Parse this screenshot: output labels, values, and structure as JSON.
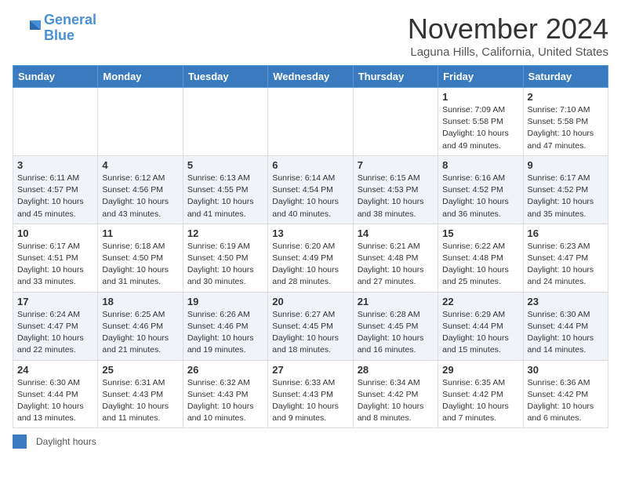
{
  "header": {
    "logo_general": "General",
    "logo_blue": "Blue",
    "month_title": "November 2024",
    "location": "Laguna Hills, California, United States"
  },
  "days_of_week": [
    "Sunday",
    "Monday",
    "Tuesday",
    "Wednesday",
    "Thursday",
    "Friday",
    "Saturday"
  ],
  "weeks": [
    [
      {
        "day": "",
        "info": ""
      },
      {
        "day": "",
        "info": ""
      },
      {
        "day": "",
        "info": ""
      },
      {
        "day": "",
        "info": ""
      },
      {
        "day": "",
        "info": ""
      },
      {
        "day": "1",
        "info": "Sunrise: 7:09 AM\nSunset: 5:58 PM\nDaylight: 10 hours and 49 minutes."
      },
      {
        "day": "2",
        "info": "Sunrise: 7:10 AM\nSunset: 5:58 PM\nDaylight: 10 hours and 47 minutes."
      }
    ],
    [
      {
        "day": "3",
        "info": "Sunrise: 6:11 AM\nSunset: 4:57 PM\nDaylight: 10 hours and 45 minutes."
      },
      {
        "day": "4",
        "info": "Sunrise: 6:12 AM\nSunset: 4:56 PM\nDaylight: 10 hours and 43 minutes."
      },
      {
        "day": "5",
        "info": "Sunrise: 6:13 AM\nSunset: 4:55 PM\nDaylight: 10 hours and 41 minutes."
      },
      {
        "day": "6",
        "info": "Sunrise: 6:14 AM\nSunset: 4:54 PM\nDaylight: 10 hours and 40 minutes."
      },
      {
        "day": "7",
        "info": "Sunrise: 6:15 AM\nSunset: 4:53 PM\nDaylight: 10 hours and 38 minutes."
      },
      {
        "day": "8",
        "info": "Sunrise: 6:16 AM\nSunset: 4:52 PM\nDaylight: 10 hours and 36 minutes."
      },
      {
        "day": "9",
        "info": "Sunrise: 6:17 AM\nSunset: 4:52 PM\nDaylight: 10 hours and 35 minutes."
      }
    ],
    [
      {
        "day": "10",
        "info": "Sunrise: 6:17 AM\nSunset: 4:51 PM\nDaylight: 10 hours and 33 minutes."
      },
      {
        "day": "11",
        "info": "Sunrise: 6:18 AM\nSunset: 4:50 PM\nDaylight: 10 hours and 31 minutes."
      },
      {
        "day": "12",
        "info": "Sunrise: 6:19 AM\nSunset: 4:50 PM\nDaylight: 10 hours and 30 minutes."
      },
      {
        "day": "13",
        "info": "Sunrise: 6:20 AM\nSunset: 4:49 PM\nDaylight: 10 hours and 28 minutes."
      },
      {
        "day": "14",
        "info": "Sunrise: 6:21 AM\nSunset: 4:48 PM\nDaylight: 10 hours and 27 minutes."
      },
      {
        "day": "15",
        "info": "Sunrise: 6:22 AM\nSunset: 4:48 PM\nDaylight: 10 hours and 25 minutes."
      },
      {
        "day": "16",
        "info": "Sunrise: 6:23 AM\nSunset: 4:47 PM\nDaylight: 10 hours and 24 minutes."
      }
    ],
    [
      {
        "day": "17",
        "info": "Sunrise: 6:24 AM\nSunset: 4:47 PM\nDaylight: 10 hours and 22 minutes."
      },
      {
        "day": "18",
        "info": "Sunrise: 6:25 AM\nSunset: 4:46 PM\nDaylight: 10 hours and 21 minutes."
      },
      {
        "day": "19",
        "info": "Sunrise: 6:26 AM\nSunset: 4:46 PM\nDaylight: 10 hours and 19 minutes."
      },
      {
        "day": "20",
        "info": "Sunrise: 6:27 AM\nSunset: 4:45 PM\nDaylight: 10 hours and 18 minutes."
      },
      {
        "day": "21",
        "info": "Sunrise: 6:28 AM\nSunset: 4:45 PM\nDaylight: 10 hours and 16 minutes."
      },
      {
        "day": "22",
        "info": "Sunrise: 6:29 AM\nSunset: 4:44 PM\nDaylight: 10 hours and 15 minutes."
      },
      {
        "day": "23",
        "info": "Sunrise: 6:30 AM\nSunset: 4:44 PM\nDaylight: 10 hours and 14 minutes."
      }
    ],
    [
      {
        "day": "24",
        "info": "Sunrise: 6:30 AM\nSunset: 4:44 PM\nDaylight: 10 hours and 13 minutes."
      },
      {
        "day": "25",
        "info": "Sunrise: 6:31 AM\nSunset: 4:43 PM\nDaylight: 10 hours and 11 minutes."
      },
      {
        "day": "26",
        "info": "Sunrise: 6:32 AM\nSunset: 4:43 PM\nDaylight: 10 hours and 10 minutes."
      },
      {
        "day": "27",
        "info": "Sunrise: 6:33 AM\nSunset: 4:43 PM\nDaylight: 10 hours and 9 minutes."
      },
      {
        "day": "28",
        "info": "Sunrise: 6:34 AM\nSunset: 4:42 PM\nDaylight: 10 hours and 8 minutes."
      },
      {
        "day": "29",
        "info": "Sunrise: 6:35 AM\nSunset: 4:42 PM\nDaylight: 10 hours and 7 minutes."
      },
      {
        "day": "30",
        "info": "Sunrise: 6:36 AM\nSunset: 4:42 PM\nDaylight: 10 hours and 6 minutes."
      }
    ]
  ],
  "footer": {
    "color_label": "Daylight hours"
  }
}
